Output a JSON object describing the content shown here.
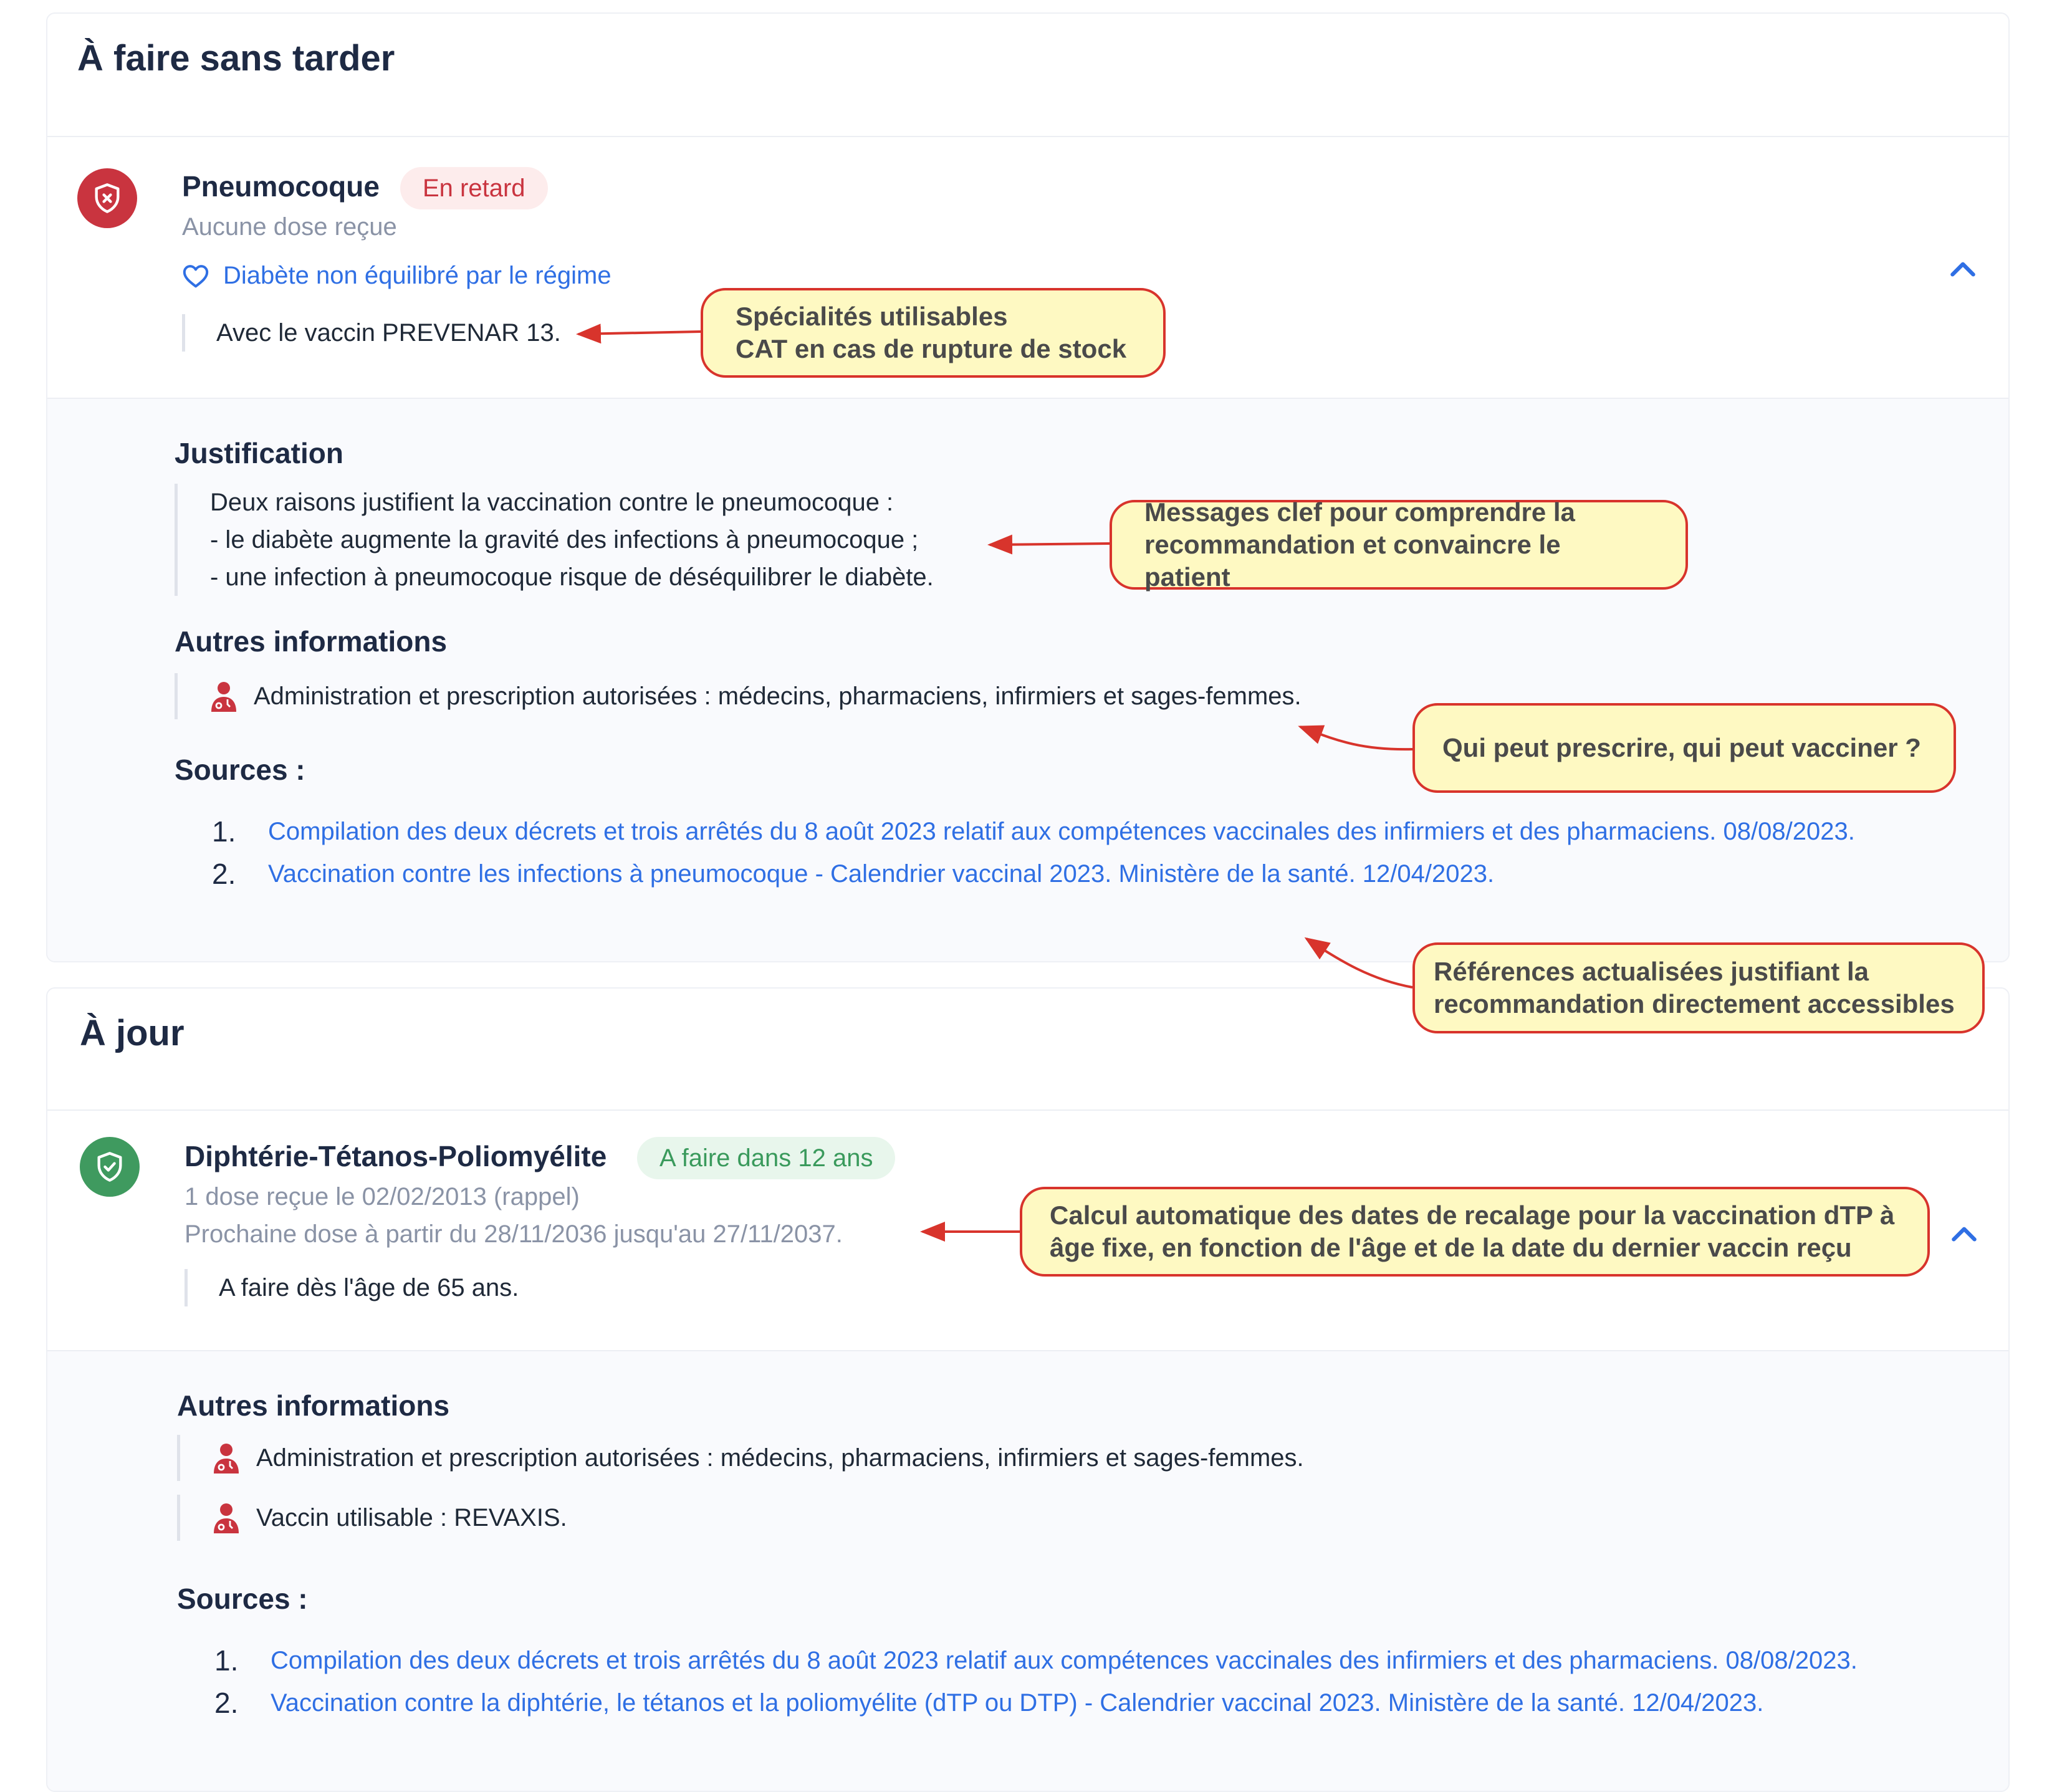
{
  "sections": [
    {
      "title": "À faire sans tarder",
      "vaccine": {
        "name": "Pneumocoque",
        "badge": "En retard",
        "subtitle": "Aucune dose reçue",
        "condition": "Diabète non équilibré par le régime",
        "note": "Avec le vaccin PREVENAR 13."
      },
      "details": {
        "justification_title": "Justification",
        "justification_lines": [
          "Deux raisons justifient la vaccination contre le pneumocoque :",
          "- le diabète augmente la gravité des infections à pneumocoque ;",
          "- une infection à pneumocoque risque de déséquilibrer le diabète."
        ],
        "other_title": "Autres informations",
        "other_items": [
          "Administration et prescription autorisées : médecins, pharmaciens, infirmiers et sages-femmes."
        ],
        "sources_title": "Sources :",
        "sources": [
          {
            "num": "1.",
            "text": "Compilation des deux décrets et trois arrêtés du 8 août 2023 relatif aux compétences vaccinales des infirmiers et des pharmaciens. 08/08/2023."
          },
          {
            "num": "2.",
            "text": "Vaccination contre les infections à pneumocoque - Calendrier vaccinal 2023. Ministère de la santé. 12/04/2023."
          }
        ]
      }
    },
    {
      "title": "À jour",
      "vaccine": {
        "name": "Diphtérie-Tétanos-Poliomyélite",
        "badge": "A faire dans 12 ans",
        "subtitle": "1 dose reçue le 02/02/2013 (rappel)",
        "next_dose": "Prochaine dose à partir du 28/11/2036 jusqu'au 27/11/2037.",
        "note": "A faire dès l'âge de 65 ans."
      },
      "details": {
        "other_title": "Autres informations",
        "other_items": [
          "Administration et prescription autorisées : médecins, pharmaciens, infirmiers et sages-femmes.",
          "Vaccin utilisable : REVAXIS."
        ],
        "sources_title": "Sources :",
        "sources": [
          {
            "num": "1.",
            "text": "Compilation des deux décrets et trois arrêtés du 8 août 2023 relatif aux compétences vaccinales des infirmiers et des pharmaciens. 08/08/2023."
          },
          {
            "num": "2.",
            "text": "Vaccination contre la diphtérie, le tétanos et la poliomyélite (dTP ou DTP) - Calendrier vaccinal 2023. Ministère de la santé. 12/04/2023."
          }
        ]
      }
    }
  ],
  "callouts": [
    "Spécialités utilisables\nCAT en cas de rupture de stock",
    "Messages clef pour comprendre la\nrecommandation et convaincre le patient",
    "Qui peut prescrire, qui peut vacciner ?",
    "Références actualisées justifiant la\nrecommandation directement accessibles",
    "Calcul automatique des dates de recalage pour la vaccination dTP à\nâge fixe, en fonction de l'âge et de la date du dernier vaccin reçu"
  ],
  "icons": {
    "overdue": "shield-x-icon",
    "up_to_date": "shield-check-icon",
    "condition": "heart-icon",
    "info": "doctor-icon",
    "expand": "chevron-up-icon"
  },
  "colors": {
    "title": "#1e2a44",
    "link": "#2f6fe4",
    "danger": "#c9343f",
    "success": "#3f9a5f",
    "callout_bg": "#fef9c2",
    "callout_border": "#d8342c"
  }
}
